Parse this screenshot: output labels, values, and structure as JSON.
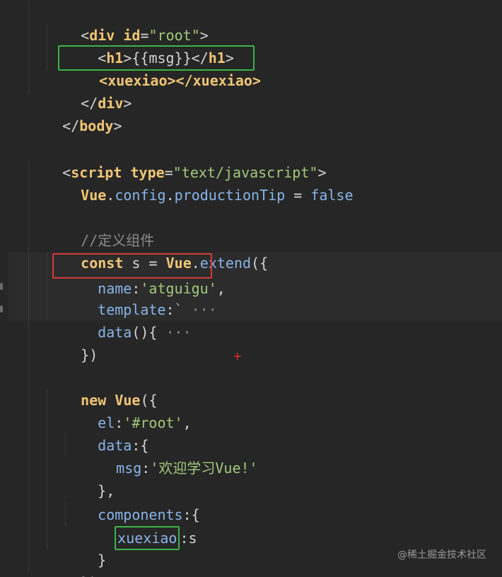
{
  "editor": {
    "lines": {
      "l1": {
        "open": "<",
        "tag": "div",
        "attr": " id",
        "eq": "=",
        "val": "\"root\"",
        "close": ">"
      },
      "l2": {
        "open": "<",
        "tag": "h1",
        "close": ">",
        "text": "{{msg}}",
        "end_open": "</",
        "end_tag": "h1",
        "end_close": ">"
      },
      "l3": {
        "text": "<xuexiao></xuexiao>"
      },
      "l4": {
        "open": "</",
        "tag": "div",
        "close": ">"
      },
      "l5": {
        "open": "</",
        "tag": "body",
        "close": ">"
      },
      "l7": {
        "open": "<",
        "tag": "script",
        "attr": " type",
        "eq": "=",
        "val": "\"text/javascript\"",
        "close": ">"
      },
      "l8": {
        "obj": "Vue",
        "dot1": ".",
        "p1": "config",
        "dot2": ".",
        "p2": "productionTip",
        "eq": " = ",
        "val": "false"
      },
      "l10": {
        "comment": "//定义组件"
      },
      "l11": {
        "kw": "const",
        "name": " s ",
        "eq": "= ",
        "obj": "Vue",
        "dot": ".",
        "fn": "extend",
        "paren": "({"
      },
      "l12": {
        "key": "name",
        "colon": ":",
        "val": "'atguigu'",
        "comma": ","
      },
      "l13": {
        "key": "template",
        "colon": ":",
        "tick": "`",
        "fold": " ···"
      },
      "l14": {
        "key": "data",
        "parens": "(){",
        "fold": " ···"
      },
      "l15": {
        "text": "})"
      },
      "l17": {
        "kw": "new",
        "obj": " Vue",
        "paren": "({"
      },
      "l18": {
        "key": "el",
        "colon": ":",
        "val": "'#root'",
        "comma": ","
      },
      "l19": {
        "key": "data",
        "brace": ":{"
      },
      "l20": {
        "key": "msg",
        "colon": ":",
        "val": "'欢迎学习Vue!'"
      },
      "l21": {
        "text": "},"
      },
      "l22": {
        "key": "components",
        "brace": ":{"
      },
      "l23": {
        "key": "xuexiao",
        "colon": ":",
        "val": "s"
      },
      "l24": {
        "text": "}"
      },
      "l25": {
        "text": "})"
      }
    }
  },
  "plus_marker": "+",
  "watermark": "@稀土掘金技术社区",
  "colors": {
    "background": "#262626",
    "tag": "#f0c674",
    "string": "#a3c97a",
    "identifier": "#7fb0e0",
    "comment": "#8a8a8a",
    "green_box": "#3db34a",
    "red_box": "#d43a3a"
  }
}
